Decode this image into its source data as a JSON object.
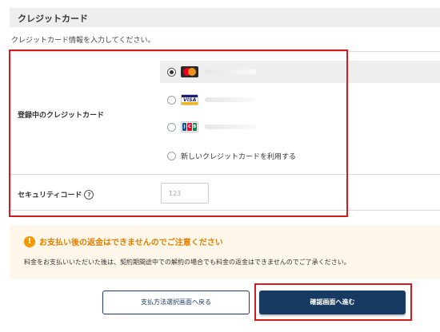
{
  "section": {
    "title": "クレジットカード",
    "intro": "クレジットカード情報を入力してください。"
  },
  "saved_cards": {
    "label": "登録中のクレジットカード",
    "options": [
      {
        "brand": "mastercard-logo",
        "selected": true
      },
      {
        "brand": "visa-logo",
        "selected": false,
        "logo_text": "VISA"
      },
      {
        "brand": "jcb-logo",
        "selected": false,
        "logo_letters": [
          "J",
          "C",
          "B"
        ]
      }
    ],
    "new_card_label": "新しいクレジットカードを利用する"
  },
  "security_code": {
    "label": "セキュリティコード",
    "help_glyph": "?",
    "placeholder": "123",
    "value": ""
  },
  "notice": {
    "icon_glyph": "!",
    "title": "お支払い後の返金はできませんのでご注意ください",
    "body": "料金をお支払いいただいた後は、契約期間途中での解約の場合でも料金の返金はできませんのでご了承ください。"
  },
  "buttons": {
    "back_label": "支払方法選択画面へ戻る",
    "confirm_label": "確認画面へ進む"
  },
  "colors": {
    "highlight_border": "#d71920",
    "primary_navy": "#163a61",
    "warning_orange": "#f39800",
    "notice_background": "#fff7ea"
  }
}
